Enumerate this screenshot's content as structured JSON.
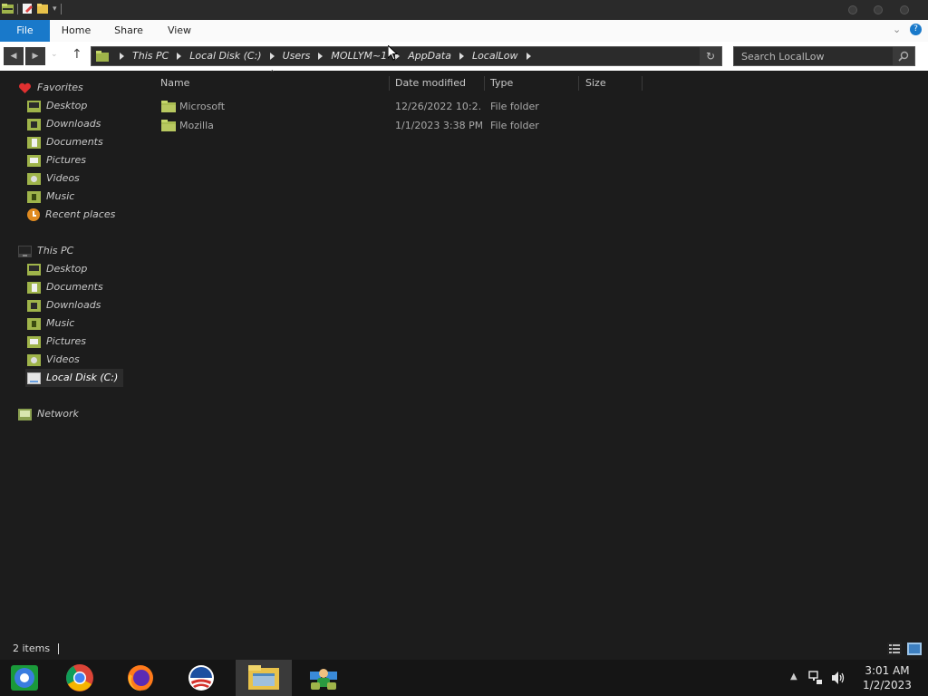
{
  "ribbon": {
    "tabs": [
      "File",
      "Home",
      "Share",
      "View"
    ]
  },
  "address": {
    "crumbs": [
      "This PC",
      "Local Disk (C:)",
      "Users",
      "MOLLYM~1",
      "AppData",
      "LocalLow"
    ]
  },
  "search": {
    "placeholder": "Search LocalLow"
  },
  "nav": {
    "favorites": {
      "label": "Favorites",
      "items": [
        {
          "label": "Desktop",
          "icon": "desktop-icon"
        },
        {
          "label": "Downloads",
          "icon": "downloads-icon"
        },
        {
          "label": "Documents",
          "icon": "documents-icon"
        },
        {
          "label": "Pictures",
          "icon": "pictures-icon"
        },
        {
          "label": "Videos",
          "icon": "videos-icon"
        },
        {
          "label": "Music",
          "icon": "music-icon"
        },
        {
          "label": "Recent places",
          "icon": "recent-places-icon"
        }
      ]
    },
    "this_pc": {
      "label": "This PC",
      "items": [
        {
          "label": "Desktop",
          "icon": "desktop-icon"
        },
        {
          "label": "Documents",
          "icon": "documents-icon"
        },
        {
          "label": "Downloads",
          "icon": "downloads-icon"
        },
        {
          "label": "Music",
          "icon": "music-icon"
        },
        {
          "label": "Pictures",
          "icon": "pictures-icon"
        },
        {
          "label": "Videos",
          "icon": "videos-icon"
        },
        {
          "label": "Local Disk (C:)",
          "icon": "local-disk-icon",
          "selected": true
        }
      ]
    },
    "network": {
      "label": "Network"
    }
  },
  "columns": {
    "name": "Name",
    "date": "Date modified",
    "type": "Type",
    "size": "Size"
  },
  "files": [
    {
      "name": "Microsoft",
      "date": "12/26/2022 10:2...",
      "type": "File folder",
      "size": ""
    },
    {
      "name": "Mozilla",
      "date": "1/1/2023 3:38 PM",
      "type": "File folder",
      "size": ""
    }
  ],
  "status": {
    "count": "2 items"
  },
  "taskbar": {
    "apps": [
      "chromium-icon",
      "chrome-icon",
      "firefox-icon",
      "obama-campaign-icon",
      "file-explorer-icon",
      "network-people-icon"
    ],
    "time": "3:01 AM",
    "date": "1/2/2023"
  },
  "colors": {
    "accent": "#1979ca",
    "background": "#1c1c1c",
    "folder": "#b8c860"
  }
}
